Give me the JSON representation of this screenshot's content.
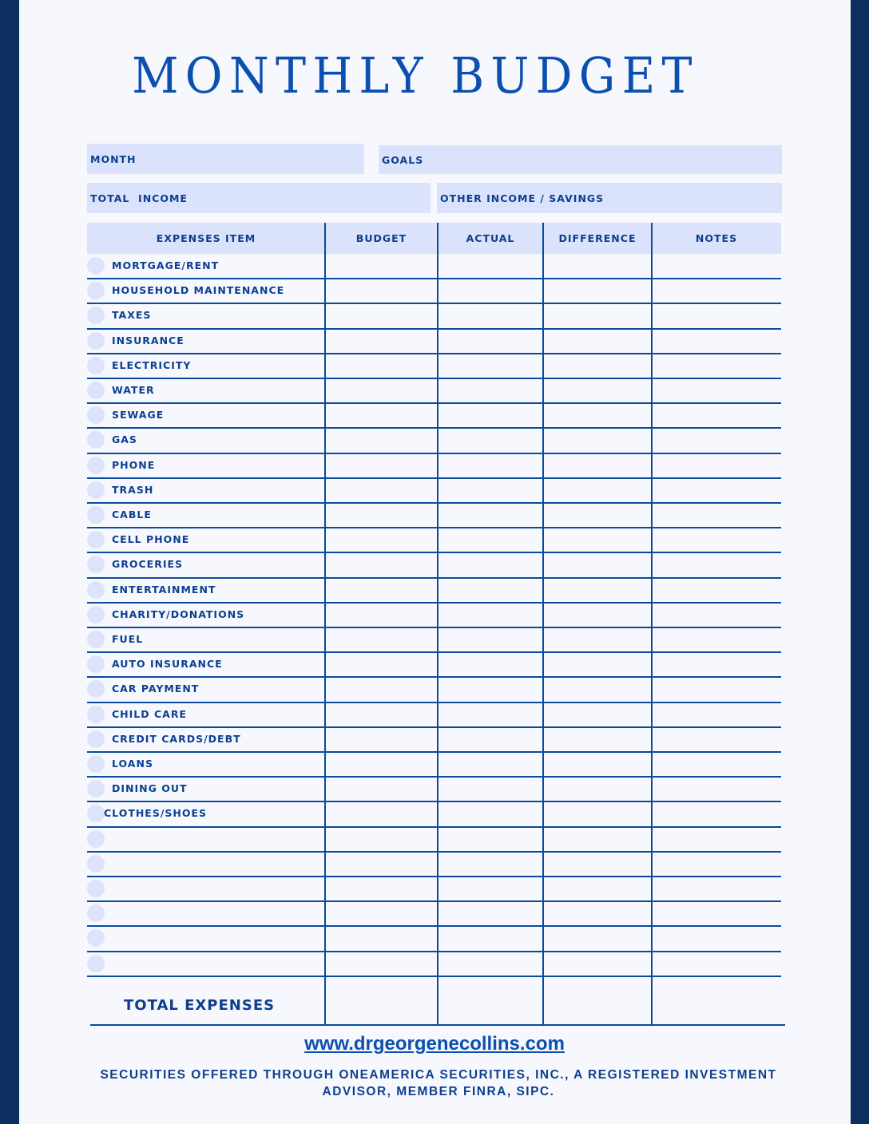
{
  "title": "MONTHLY BUDGET",
  "fields": {
    "month": {
      "label": "MONTH",
      "value": ""
    },
    "goals": {
      "label": "GOALS",
      "value": ""
    },
    "total_income": {
      "label": "TOTAL  INCOME",
      "value": ""
    },
    "other_income": {
      "label": "OTHER INCOME / SAVINGS",
      "value": ""
    }
  },
  "table": {
    "columns": [
      "EXPENSES ITEM",
      "BUDGET",
      "ACTUAL",
      "DIFFERENCE",
      "NOTES"
    ],
    "rows": [
      "MORTGAGE/RENT",
      "HOUSEHOLD MAINTENANCE",
      "TAXES",
      "INSURANCE",
      "ELECTRICITY",
      "WATER",
      "SEWAGE",
      "GAS",
      "PHONE",
      "TRASH",
      "CABLE",
      "CELL PHONE",
      "GROCERIES",
      "ENTERTAINMENT",
      "CHARITY/DONATIONS",
      "FUEL",
      "AUTO INSURANCE",
      "CAR PAYMENT",
      "CHILD CARE",
      "CREDIT CARDS/DEBT",
      "LOANS",
      "DINING OUT",
      "CLOTHES/SHOES",
      "",
      "",
      "",
      "",
      "",
      ""
    ],
    "total_label": "TOTAL EXPENSES"
  },
  "footer": {
    "url": "www.drgeorgenecollins.com",
    "disclaimer": "SECURITIES OFFERED THROUGH ONEAMERICA SECURITIES, INC., A REGISTERED INVESTMENT ADVISOR, MEMBER FINRA, SIPC."
  },
  "colors": {
    "accent": "#0b4fb0",
    "border": "#0b2f5e",
    "fill": "#dbe2fb"
  }
}
